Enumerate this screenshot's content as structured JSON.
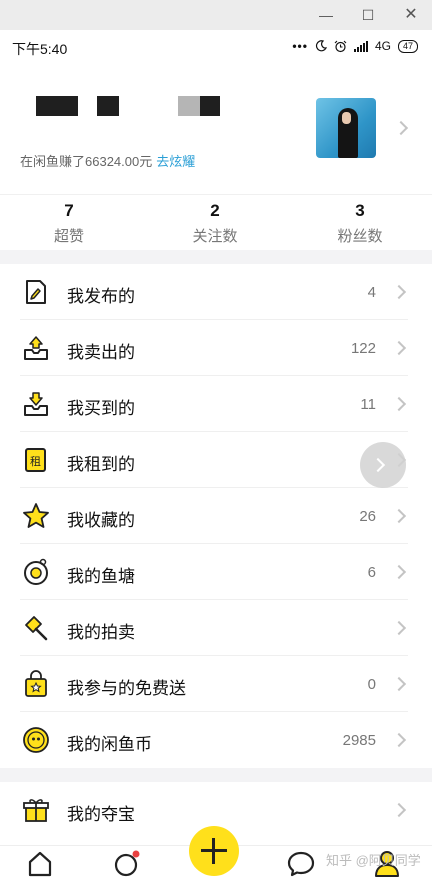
{
  "window": {
    "minimize": "—",
    "maximize": "☐",
    "close": "✕"
  },
  "status_bar": {
    "time": "下午5:40",
    "dots": "•••",
    "network": "4G",
    "battery": "47"
  },
  "profile": {
    "earned_text": "在闲鱼赚了66324.00元",
    "show_off_link": "去炫耀"
  },
  "stats": [
    {
      "value": "7",
      "label": "超赞"
    },
    {
      "value": "2",
      "label": "关注数"
    },
    {
      "value": "3",
      "label": "粉丝数"
    }
  ],
  "menu": [
    {
      "icon": "document-edit-icon",
      "label": "我发布的",
      "count": "4"
    },
    {
      "icon": "box-upload-icon",
      "label": "我卖出的",
      "count": "122"
    },
    {
      "icon": "box-download-icon",
      "label": "我买到的",
      "count": "11"
    },
    {
      "icon": "rent-icon",
      "label": "我租到的",
      "count": ""
    },
    {
      "icon": "star-icon",
      "label": "我收藏的",
      "count": "26"
    },
    {
      "icon": "fish-pond-icon",
      "label": "我的鱼塘",
      "count": "6"
    },
    {
      "icon": "auction-icon",
      "label": "我的拍卖",
      "count": ""
    },
    {
      "icon": "gift-bag-icon",
      "label": "我参与的免费送",
      "count": "0"
    },
    {
      "icon": "coin-icon",
      "label": "我的闲鱼币",
      "count": "2985"
    },
    {
      "icon": "gift-box-icon",
      "label": "我的夺宝",
      "count": ""
    }
  ],
  "tabbar": {
    "home": "home-icon",
    "fish_pond": "fish-pond-tab-icon",
    "publish": "plus-icon",
    "messages": "chat-icon",
    "profile": "user-icon"
  },
  "watermark": "知乎 @阿贝同学",
  "colors": {
    "accent": "#ffe01b",
    "link": "#2b9fd6",
    "badge": "#e84040"
  }
}
